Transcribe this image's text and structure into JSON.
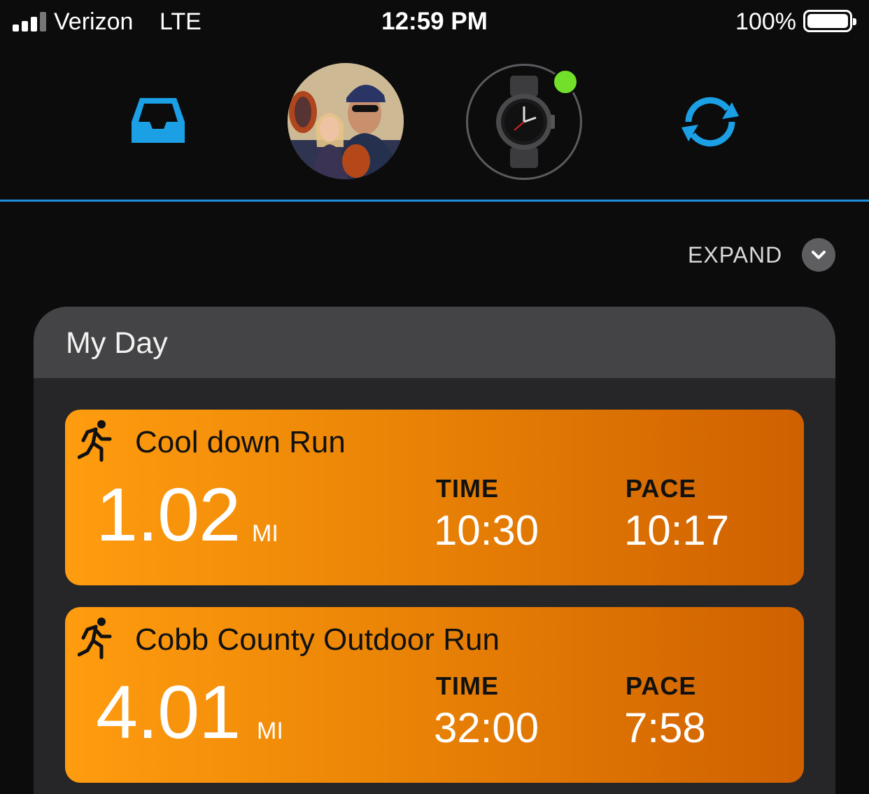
{
  "status_bar": {
    "carrier": "Verizon",
    "network": "LTE",
    "time": "12:59 PM",
    "battery": "100%"
  },
  "header": {
    "icons": [
      "inbox-icon",
      "profile-avatar",
      "watch-device",
      "sync-icon"
    ],
    "device_status_color": "#72e02a",
    "accent_color": "#1e8fdc"
  },
  "expand": {
    "label": "EXPAND"
  },
  "my_day": {
    "title": "My Day",
    "activities": [
      {
        "name": "Cool down Run",
        "distance": "1.02",
        "unit": "MI",
        "time_label": "TIME",
        "time": "10:30",
        "pace_label": "PACE",
        "pace": "10:17"
      },
      {
        "name": "Cobb County Outdoor Run",
        "distance": "4.01",
        "unit": "MI",
        "time_label": "TIME",
        "time": "32:00",
        "pace_label": "PACE",
        "pace": "7:58"
      }
    ]
  }
}
